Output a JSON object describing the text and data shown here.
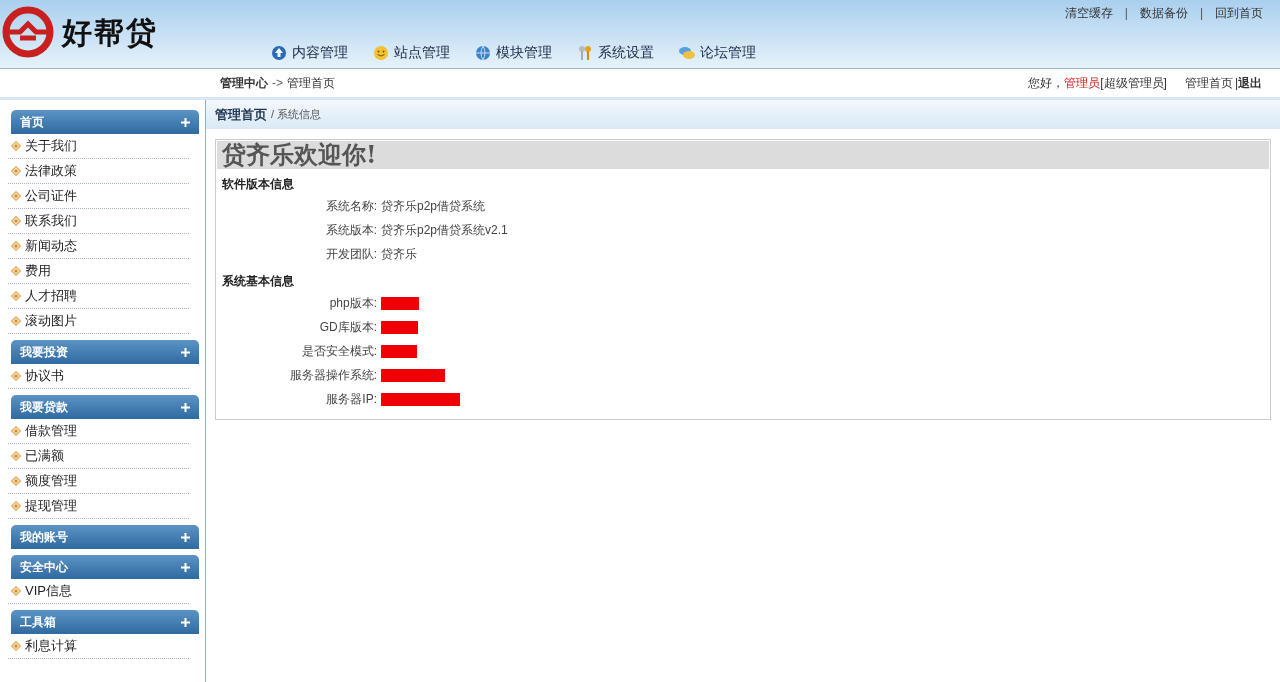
{
  "logo": {
    "text": "好帮贷"
  },
  "top_links": [
    {
      "kind": "link",
      "text": "清空缓存"
    },
    {
      "kind": "sep",
      "text": "|"
    },
    {
      "kind": "link",
      "text": "数据备份"
    },
    {
      "kind": "sep",
      "text": "|"
    },
    {
      "kind": "link",
      "text": "回到首页"
    }
  ],
  "nav": [
    {
      "label": "内容管理"
    },
    {
      "label": "站点管理"
    },
    {
      "label": "模块管理"
    },
    {
      "label": "系统设置"
    },
    {
      "label": "论坛管理"
    }
  ],
  "breadcrumb": {
    "root": "管理中心",
    "sep": "->",
    "current": "管理首页"
  },
  "user_bar": {
    "greeting": "您好，",
    "user": "管理员",
    "role": "[超级管理员]",
    "home": "管理首页",
    "sep": "|",
    "logout": "退出"
  },
  "sidebar": [
    {
      "title": "首页",
      "items": [
        "关于我们",
        "法律政策",
        "公司证件",
        "联系我们",
        "新闻动态",
        "费用",
        "人才招聘",
        "滚动图片"
      ]
    },
    {
      "title": "我要投资",
      "items": [
        "协议书"
      ]
    },
    {
      "title": "我要贷款",
      "items": [
        "借款管理",
        "已满额",
        "额度管理",
        "提现管理"
      ]
    },
    {
      "title": "我的账号"
    },
    {
      "title": "安全中心",
      "items": [
        "VIP信息"
      ]
    },
    {
      "title": "工具箱",
      "items": [
        "利息计算"
      ]
    }
  ],
  "content_header": {
    "title": "管理首页",
    "sub": "/ 系统信息"
  },
  "welcome": "贷齐乐欢迎你!",
  "sections": [
    {
      "title": "软件版本信息",
      "rows": [
        {
          "label": "系统名称:",
          "kind": "text",
          "value": "贷齐乐p2p借贷系统"
        },
        {
          "label": "系统版本:",
          "kind": "text",
          "value": "贷齐乐p2p借贷系统v2.1"
        },
        {
          "label": "开发团队:",
          "kind": "text",
          "value": "贷齐乐"
        }
      ]
    },
    {
      "title": "系统基本信息",
      "rows": [
        {
          "label": "php版本:",
          "kind": "redacted"
        },
        {
          "label": "GD库版本:",
          "kind": "redacted"
        },
        {
          "label": "是否安全模式:",
          "kind": "redacted"
        },
        {
          "label": "服务器操作系统:",
          "kind": "redacted"
        },
        {
          "label": "服务器IP:",
          "kind": "redacted"
        }
      ]
    }
  ]
}
